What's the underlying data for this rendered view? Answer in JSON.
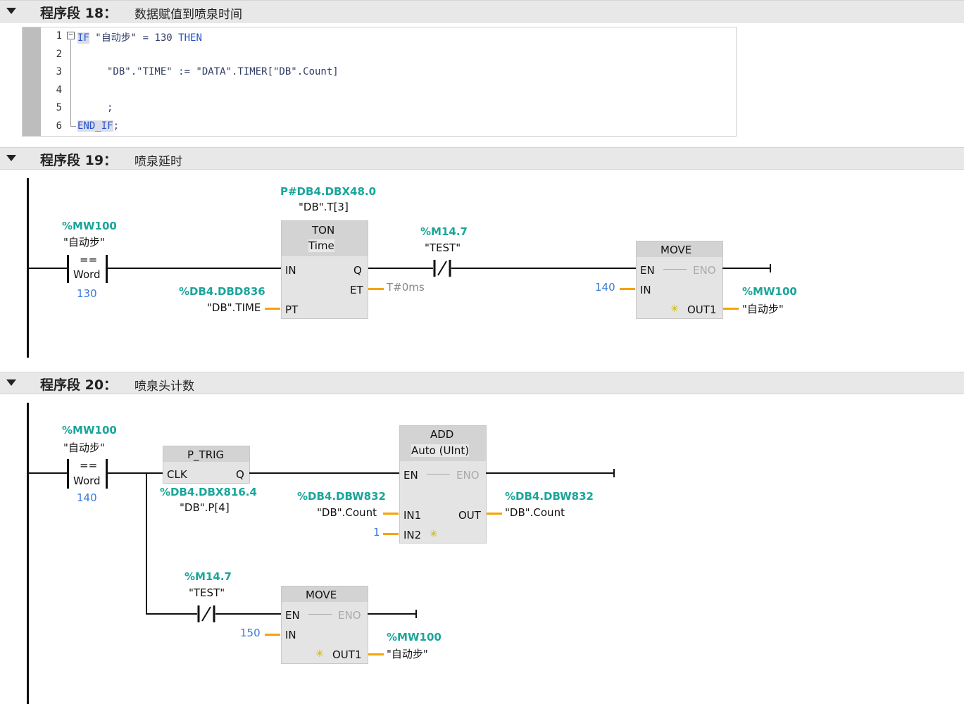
{
  "segments": [
    {
      "title": "程序段 18：",
      "comment": "数据赋值到喷泉时间"
    },
    {
      "title": "程序段 19：",
      "comment": "喷泉延时"
    },
    {
      "title": "程序段 20：",
      "comment": "喷泉头计数"
    }
  ],
  "scl": {
    "lines": [
      "1",
      "2",
      "3",
      "4",
      "5",
      "6"
    ],
    "l1_kw": "IF",
    "l1_rest": " \"自动步\" = 130 ",
    "l1_then": "THEN",
    "l3": "\"DB\".\"TIME\" := \"DATA\".TIMER[\"DB\".Count]",
    "l5": ";",
    "l6_kw": "END_IF",
    "l6_rest": ";"
  },
  "n19": {
    "cmp_addr": "%MW100",
    "cmp_name": "\"自动步\"",
    "cmp_op": "==",
    "cmp_type": "Word",
    "cmp_val": "130",
    "ton_instance_addr": "P#DB4.DBX48.0",
    "ton_instance_name": "\"DB\".T[3]",
    "ton_title": "TON",
    "ton_type": "Time",
    "ton_in": "IN",
    "ton_q": "Q",
    "ton_et": "ET",
    "ton_pt": "PT",
    "et_val": "T#0ms",
    "pt_addr": "%DB4.DBD836",
    "pt_name": "\"DB\".TIME",
    "nc_addr": "%M14.7",
    "nc_name": "\"TEST\"",
    "move_title": "MOVE",
    "move_en": "EN",
    "move_eno": "ENO",
    "move_in": "IN",
    "move_out": "OUT1",
    "move_in_val": "140",
    "out_addr": "%MW100",
    "out_name": "\"自动步\""
  },
  "n20": {
    "cmp_addr": "%MW100",
    "cmp_name": "\"自动步\"",
    "cmp_op": "==",
    "cmp_type": "Word",
    "cmp_val": "140",
    "ptrig_title": "P_TRIG",
    "ptrig_clk": "CLK",
    "ptrig_q": "Q",
    "ptrig_addr": "%DB4.DBX816.4",
    "ptrig_name": "\"DB\".P[4]",
    "add_title": "ADD",
    "add_type": "Auto (UInt)",
    "add_en": "EN",
    "add_eno": "ENO",
    "add_in1": "IN1",
    "add_in2": "IN2",
    "add_out": "OUT",
    "in1_addr": "%DB4.DBW832",
    "in1_name": "\"DB\".Count",
    "in2_val": "1",
    "out_addr": "%DB4.DBW832",
    "out_name": "\"DB\".Count",
    "nc_addr": "%M14.7",
    "nc_name": "\"TEST\"",
    "move_title": "MOVE",
    "move_en": "EN",
    "move_eno": "ENO",
    "move_in": "IN",
    "move_out": "OUT1",
    "move_in_val": "150",
    "mout_addr": "%MW100",
    "mout_name": "\"自动步\""
  },
  "colors": {
    "address": "#1aa59a",
    "constant": "#3a7ad8",
    "wire_param": "#f5a300",
    "keyword": "#2450c8"
  }
}
